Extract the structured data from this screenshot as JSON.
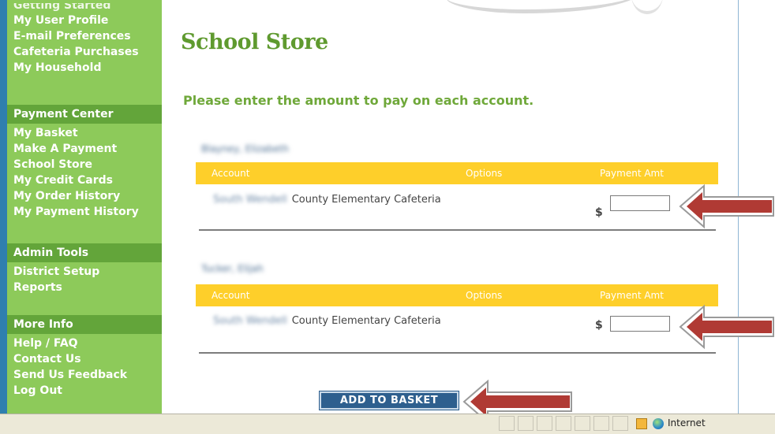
{
  "sidebar": {
    "account_links": [
      "Getting Started",
      "My User Profile",
      "E-mail Preferences",
      "Cafeteria Purchases",
      "My Household"
    ],
    "payment_center": {
      "header": "Payment Center",
      "links": [
        "My Basket",
        "Make A Payment",
        "School Store",
        "My Credit Cards",
        "My Order History",
        "My Payment History"
      ]
    },
    "admin_tools": {
      "header": "Admin Tools",
      "links": [
        "District Setup",
        "Reports"
      ]
    },
    "more_info": {
      "header": "More Info",
      "links": [
        "Help / FAQ",
        "Contact Us",
        "Send Us Feedback",
        "Log Out"
      ]
    }
  },
  "page": {
    "title": "School Store",
    "instruction": "Please enter the amount to pay on each account."
  },
  "table_headers": {
    "account": "Account",
    "options": "Options",
    "payment_amt": "Payment Amt"
  },
  "accounts": [
    {
      "student_name": "Blayney, Elizabeth",
      "school_prefix": "South Wendell",
      "school_name": "County Elementary Cafeteria",
      "currency": "$",
      "amount": ""
    },
    {
      "student_name": "Tucker, Elijah",
      "school_prefix": "South Wendell",
      "school_name": "County Elementary Cafeteria",
      "currency": "$",
      "amount": ""
    }
  ],
  "add_to_basket_label": "ADD TO BASKET",
  "status_bar": {
    "zone_label": "Internet"
  },
  "colors": {
    "sidebar": "#8dca5a",
    "sidebar_header": "#63a53a",
    "table_header": "#fecf2a",
    "title_green": "#5f9a2f",
    "button_blue": "#2e5f8e",
    "arrow_red": "#b03a34"
  },
  "icons": [
    "lock-icon",
    "internet-globe-icon",
    "arrow-left-icon"
  ]
}
